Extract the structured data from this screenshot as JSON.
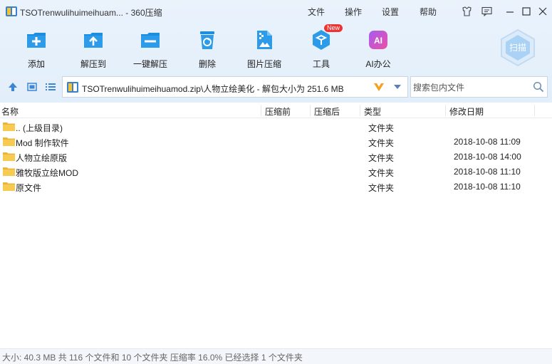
{
  "window": {
    "title": "TSOTrenwulihuimeihuam... - 360压缩",
    "menu": [
      "文件",
      "操作",
      "设置",
      "帮助"
    ]
  },
  "toolbar": {
    "items": [
      {
        "label": "添加",
        "icon": "add-icon"
      },
      {
        "label": "解压到",
        "icon": "extract-to-icon"
      },
      {
        "label": "一键解压",
        "icon": "one-click-extract-icon"
      },
      {
        "label": "删除",
        "icon": "delete-icon"
      },
      {
        "label": "图片压缩",
        "icon": "image-compress-icon"
      },
      {
        "label": "工具",
        "icon": "tools-icon",
        "badge": "New"
      },
      {
        "label": "AI办公",
        "icon": "ai-office-icon",
        "icon_text": "AI"
      }
    ],
    "scan_label": "扫描"
  },
  "address": {
    "path": "TSOTrenwulihuimeihuamod.zip\\人物立绘美化 - 解包大小为 251.6 MB"
  },
  "search": {
    "placeholder": "搜索包内文件"
  },
  "columns": {
    "name": "名称",
    "compressed_before": "压缩前",
    "compressed_after": "压缩后",
    "type": "类型",
    "modified": "修改日期"
  },
  "files": [
    {
      "name": ".. (上级目录)",
      "type": "文件夹",
      "date": ""
    },
    {
      "name": "Mod 制作软件",
      "type": "文件夹",
      "date": "2018-10-08 11:09"
    },
    {
      "name": "人物立绘原版",
      "type": "文件夹",
      "date": "2018-10-08 14:00"
    },
    {
      "name": "雅牧版立绘MOD",
      "type": "文件夹",
      "date": "2018-10-08 11:10"
    },
    {
      "name": "原文件",
      "type": "文件夹",
      "date": "2018-10-08 11:10"
    }
  ],
  "status": {
    "text": "大小: 40.3 MB 共 116 个文件和 10 个文件夹 压缩率 16.0% 已经选择 1 个文件夹"
  },
  "colors": {
    "accent": "#2a8fd6",
    "toolbar_bg": "#e6f0fb",
    "folder": "#f5c542"
  }
}
